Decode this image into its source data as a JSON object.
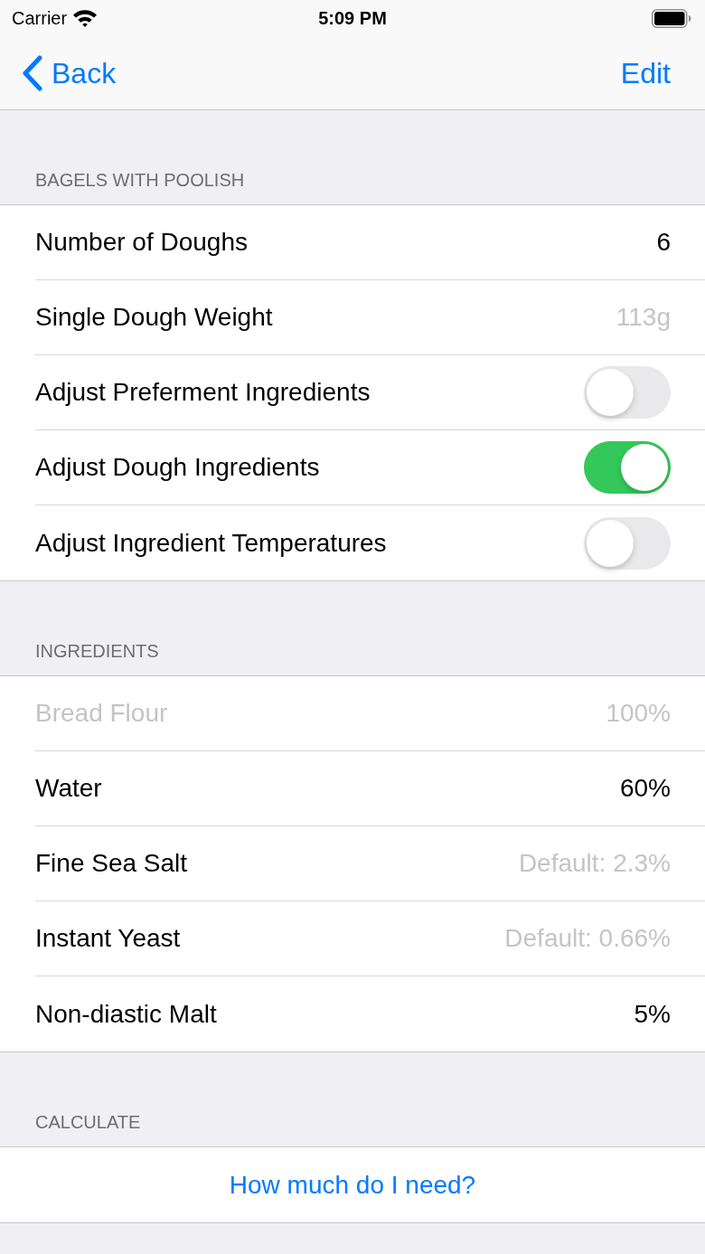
{
  "status_bar": {
    "carrier": "Carrier",
    "time": "5:09 PM"
  },
  "nav_bar": {
    "back": "Back",
    "edit": "Edit"
  },
  "sections": [
    {
      "header": "BAGELS WITH POOLISH",
      "rows": [
        {
          "kind": "field",
          "label": "Number of Doughs",
          "value": "6",
          "disabled": false
        },
        {
          "kind": "field",
          "label": "Single Dough Weight",
          "placeholder": "113g",
          "disabled": false
        },
        {
          "kind": "toggle",
          "label": "Adjust Preferment Ingredients",
          "on": false,
          "disabled": false
        },
        {
          "kind": "toggle",
          "label": "Adjust Dough Ingredients",
          "on": true,
          "disabled": false
        },
        {
          "kind": "toggle",
          "label": "Adjust Ingredient Temperatures",
          "on": false,
          "disabled": false
        }
      ]
    },
    {
      "header": "INGREDIENTS",
      "rows": [
        {
          "kind": "field",
          "label": "Bread Flour",
          "value": "100%",
          "disabled": true
        },
        {
          "kind": "field",
          "label": "Water",
          "value": "60%",
          "disabled": false
        },
        {
          "kind": "field",
          "label": "Fine Sea Salt",
          "placeholder": "Default: 2.3%",
          "disabled": false
        },
        {
          "kind": "field",
          "label": "Instant Yeast",
          "placeholder": "Default: 0.66%",
          "disabled": false
        },
        {
          "kind": "field",
          "label": "Non-diastic Malt",
          "value": "5%",
          "disabled": false
        }
      ]
    },
    {
      "header": "CALCULATE",
      "rows": [
        {
          "kind": "action",
          "label": "How much do I need?",
          "disabled": false
        }
      ]
    }
  ]
}
